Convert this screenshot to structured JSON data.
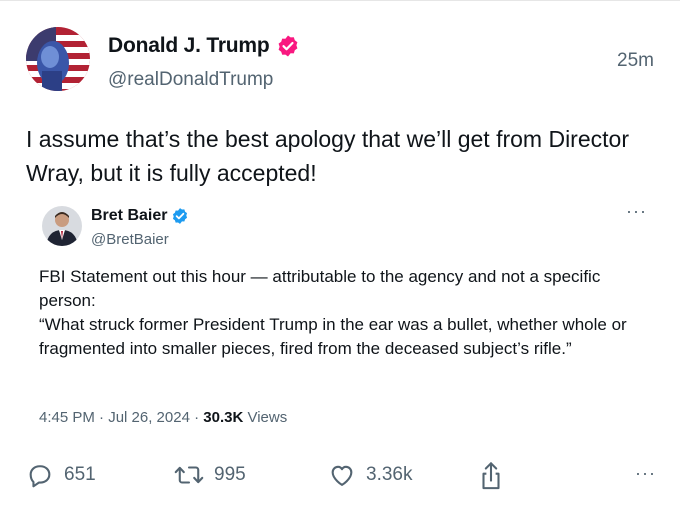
{
  "post": {
    "author_name": "Donald J. Trump",
    "author_handle": "@realDonaldTrump",
    "time_ago": "25m",
    "text": "I assume that’s the best apology that we’ll get from Director Wray, but it is fully accepted!",
    "verified_color": "#f91880"
  },
  "quote": {
    "author_name": "Bret Baier",
    "author_handle": "@BretBaier",
    "more": "···",
    "lines": [
      "FBI Statement out this hour — attributable to the agency and not a specific person:",
      "“What struck former President Trump in the ear was a bullet, whether whole or fragmented into smaller pieces, fired from the deceased subject’s rifle.”"
    ],
    "time": "4:45 PM · Jul 26, 2024 · ",
    "views_count": "30.3K",
    "views_label": " Views",
    "verified_color": "#1d9bf0"
  },
  "actions": {
    "replies": "651",
    "reposts": "995",
    "likes": "3.36k",
    "more": "···"
  }
}
